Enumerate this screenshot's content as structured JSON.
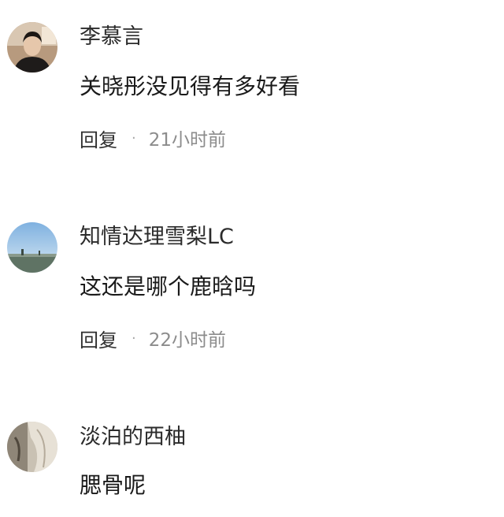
{
  "comments": [
    {
      "username": "李慕言",
      "text": "关晓彤没见得有多好看",
      "reply_label": "回复",
      "separator": "·",
      "time": "21小时前"
    },
    {
      "username": "知情达理雪梨LC",
      "text": "这还是哪个鹿晗吗",
      "reply_label": "回复",
      "separator": "·",
      "time": "22小时前"
    },
    {
      "username": "淡泊的西柚",
      "text": "腮骨呢"
    }
  ]
}
